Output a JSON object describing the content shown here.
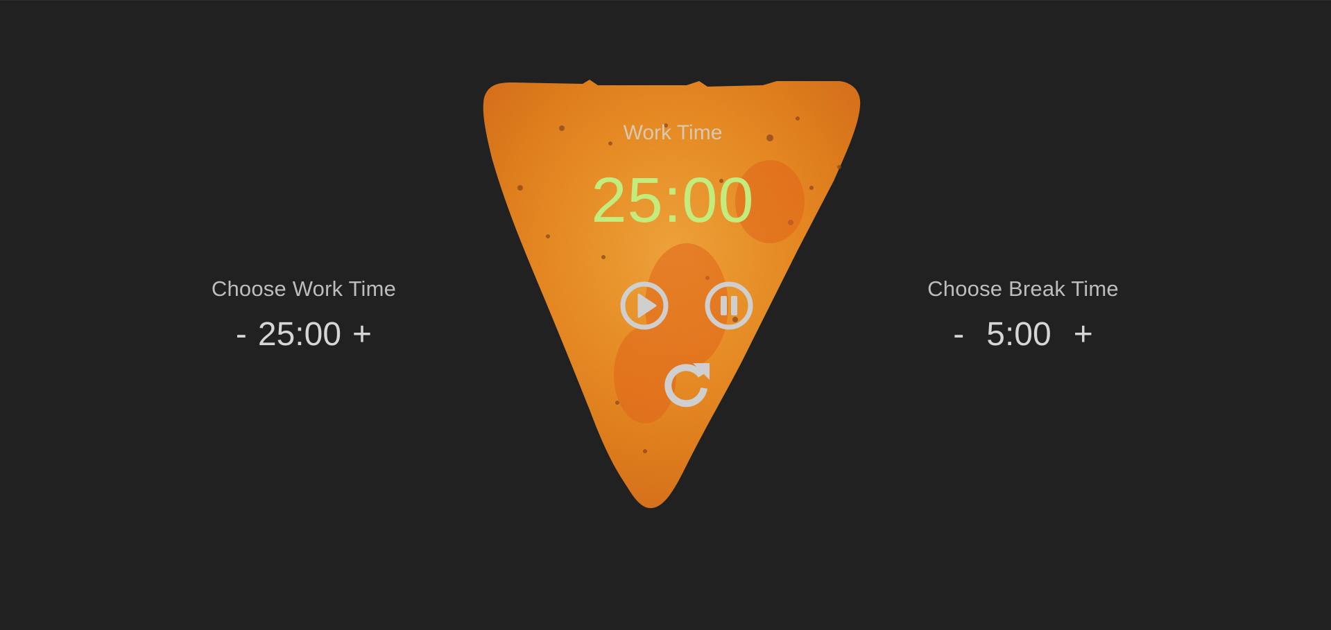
{
  "work_setting": {
    "title": "Choose Work Time",
    "minus_label": "-",
    "value": "25:00",
    "plus_label": "+"
  },
  "break_setting": {
    "title": "Choose Break Time",
    "minus_label": "-",
    "value": "5:00",
    "plus_label": "+"
  },
  "timer": {
    "mode_label": "Work Time",
    "display": "25:00"
  },
  "controls": {
    "play_icon": "play-circle",
    "pause_icon": "pause-circle",
    "reset_icon": "redo"
  },
  "colors": {
    "background": "#212121",
    "timer_text": "#c3ec7e",
    "icon": "#cfcfcf",
    "chip": "#e88a1e"
  }
}
